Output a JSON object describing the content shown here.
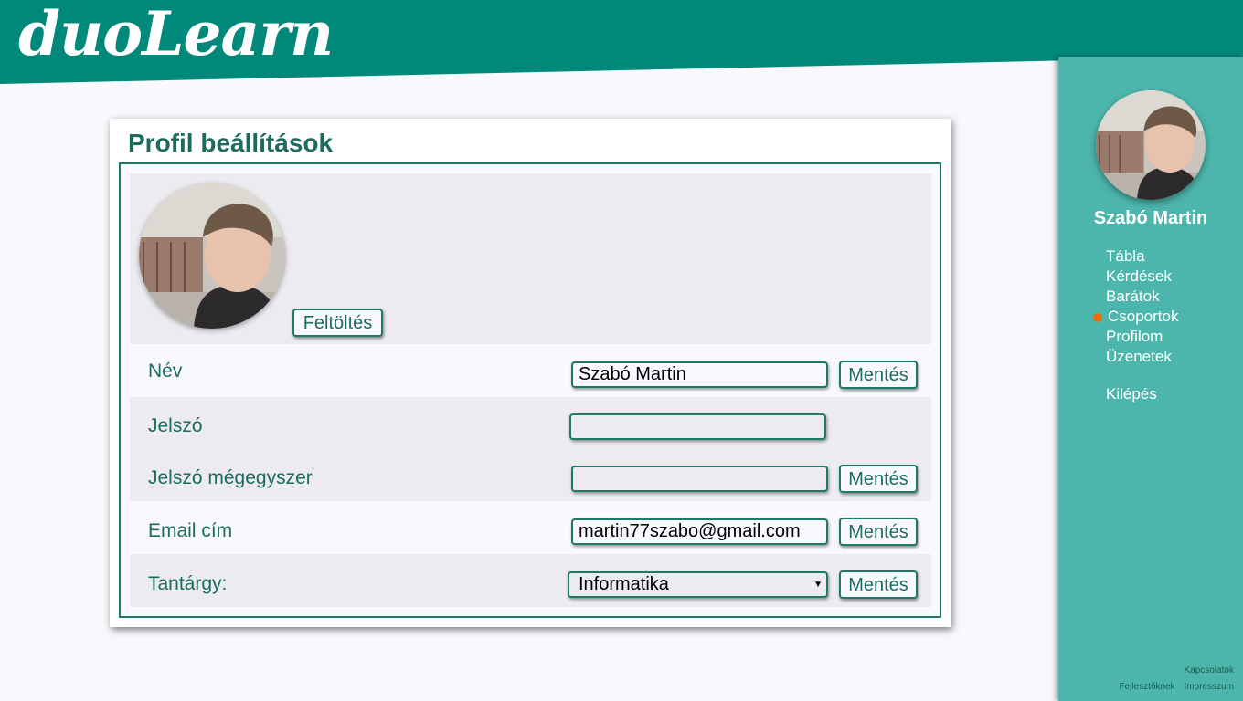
{
  "app": {
    "logo": "duoLearn"
  },
  "colors": {
    "header": "#00897b",
    "sidebar": "#4db6ac",
    "accent_text": "#1d6b5f",
    "active_dot": "#ef6c00"
  },
  "sidebar": {
    "user_name": "Szabó Martin",
    "nav": [
      "Tábla",
      "Kérdések",
      "Barátok",
      "Csoportok",
      "Profilom",
      "Üzenetek"
    ],
    "active_item": "Csoportok",
    "logout": "Kilépés",
    "footer": {
      "contacts": "Kapcsolatok",
      "developers": "Fejlesztőknek",
      "imprint": "Impresszum"
    }
  },
  "settings": {
    "title": "Profil beállítások",
    "upload_label": "Feltöltés",
    "save_label": "Mentés",
    "name": {
      "label": "Név",
      "value": "Szabó Martin"
    },
    "password": {
      "label": "Jelszó",
      "value": ""
    },
    "password_again": {
      "label": "Jelszó mégegyszer",
      "value": ""
    },
    "email": {
      "label": "Email cím",
      "value": "martin77szabo@gmail.com"
    },
    "subject": {
      "label": "Tantárgy:",
      "value": "Informatika"
    }
  }
}
